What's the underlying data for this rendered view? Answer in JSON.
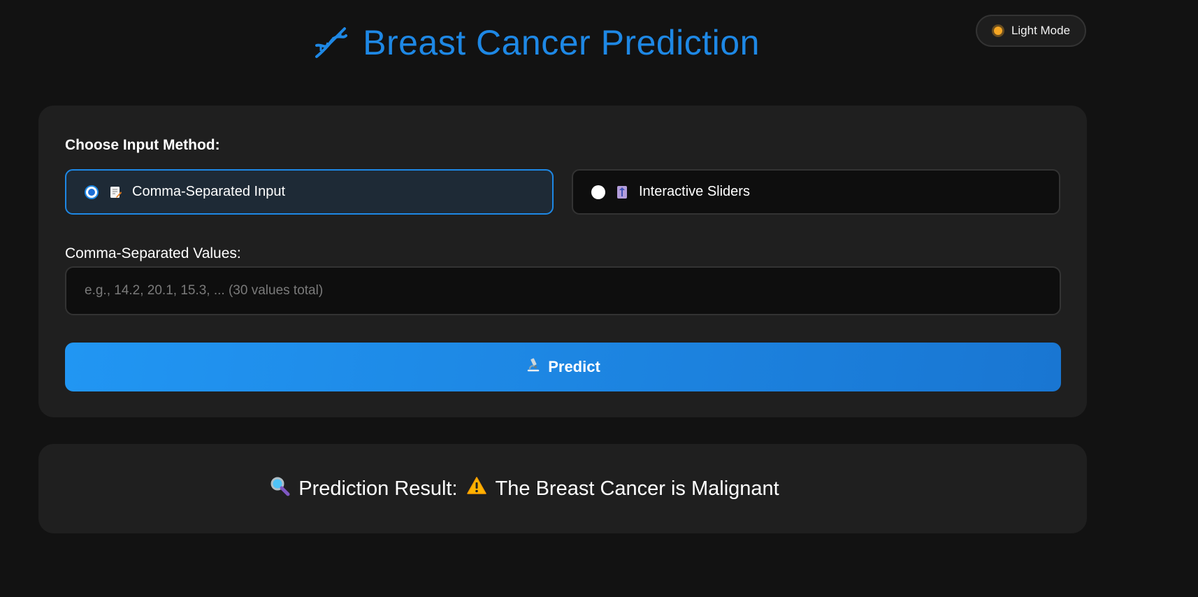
{
  "theme_toggle": {
    "label": "Light Mode",
    "icon": "sun-icon"
  },
  "header": {
    "title": "Breast Cancer Prediction",
    "icon": "dna-icon",
    "accent": "#1e88e5"
  },
  "input_method": {
    "label": "Choose Input Method:",
    "options": [
      {
        "label": "Comma-Separated Input",
        "icon": "memo-icon",
        "selected": true
      },
      {
        "label": "Interactive Sliders",
        "icon": "slider-icon",
        "selected": false
      }
    ]
  },
  "values_field": {
    "label": "Comma-Separated Values:",
    "placeholder": "e.g., 14.2, 20.1, 15.3, ... (30 values total)",
    "value": ""
  },
  "predict_button": {
    "label": "Predict",
    "icon": "microscope-icon"
  },
  "result": {
    "label": "Prediction Result:",
    "text": "The Breast Cancer is Malignant",
    "label_icon": "magnifier-icon",
    "text_icon": "warning-icon"
  }
}
